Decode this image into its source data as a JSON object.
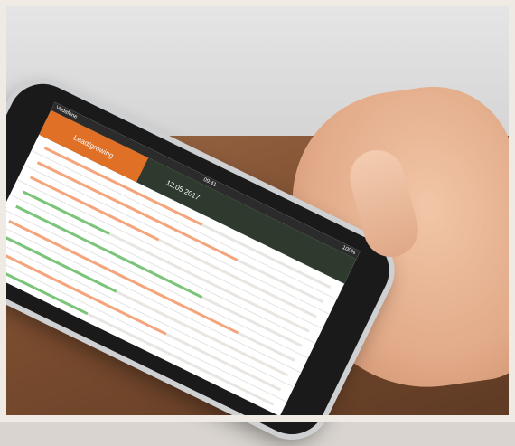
{
  "image": {
    "description_hidden": true
  },
  "app": {
    "status_left": "Vodafone",
    "status_time": "09:41",
    "status_right": "100%",
    "header_label": "Lead/growing",
    "header_date": "12.05.2017"
  },
  "rows": [
    {
      "label": "",
      "fill_pct": 55,
      "color": "#f4a57c"
    },
    {
      "label": "",
      "fill_pct": 70,
      "color": "#f4a57c"
    },
    {
      "label": "",
      "fill_pct": 45,
      "color": "#f4a57c"
    },
    {
      "label": "",
      "fill_pct": 30,
      "color": "#7bc57a"
    },
    {
      "label": "",
      "fill_pct": 65,
      "color": "#7bc57a"
    },
    {
      "label": "",
      "fill_pct": 80,
      "color": "#f4a57c"
    },
    {
      "label": "",
      "fill_pct": 40,
      "color": "#7bc57a"
    },
    {
      "label": "",
      "fill_pct": 60,
      "color": "#f4a57c"
    },
    {
      "label": "",
      "fill_pct": 35,
      "color": "#7bc57a"
    }
  ]
}
